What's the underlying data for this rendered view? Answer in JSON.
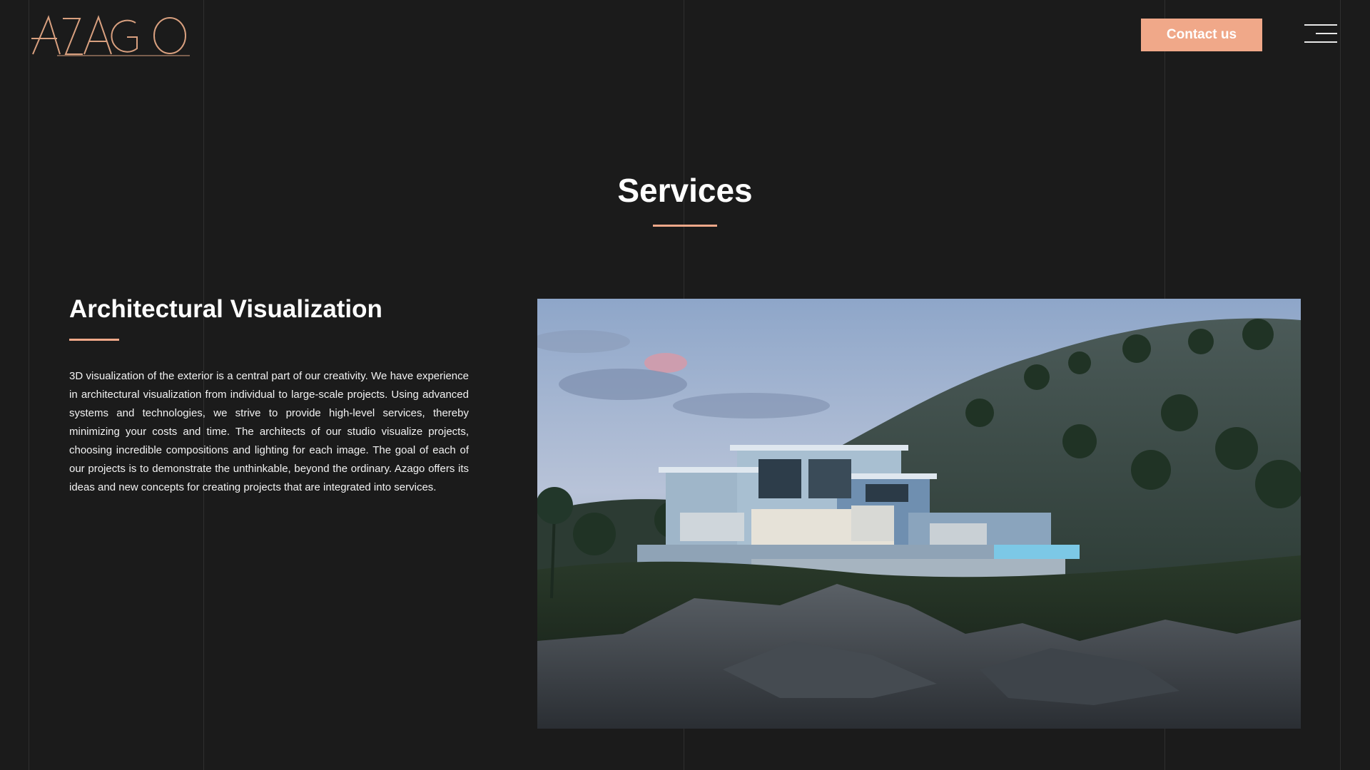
{
  "header": {
    "logo_text": "AZAGO",
    "contact_label": "Contact us",
    "menu_icon": "hamburger-menu-icon"
  },
  "section": {
    "title": "Services"
  },
  "service": {
    "title": "Architectural Visualization",
    "description": "3D visualization of the exterior is a central part of our creativity. We have experience in architectural visualization from individual to large-scale projects. Using advanced systems and technologies, we strive to provide high-level services, thereby minimizing your costs and time. The architects of our studio visualize projects, choosing incredible compositions and lighting for each image. The goal of each of our projects is to demonstrate the unthinkable, beyond the ordinary. Azago offers its ideas and new concepts for creating projects that are integrated into services.",
    "image_subject": "modern villa on a hillside at dusk with pool"
  },
  "colors": {
    "background": "#1b1b1b",
    "accent": "#f0a889",
    "text": "#ffffff",
    "grid_line": "#2f2f2f"
  }
}
